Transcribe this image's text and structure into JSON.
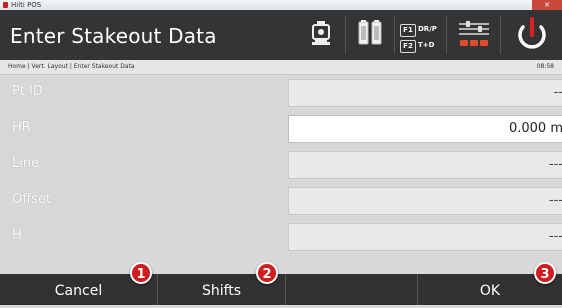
{
  "window": {
    "title": "Hilti POS",
    "close_glyph": "✕"
  },
  "header": {
    "title": "Enter Stakeout Data",
    "f1_key": "F1",
    "f1_label": "DR/P",
    "f2_key": "F2",
    "f2_label": "T+D"
  },
  "breadcrumb": {
    "path": "Home | Vert. Layout | Enter Stakeout Data",
    "time": "08:58"
  },
  "form": {
    "rows": [
      {
        "label": "Pt ID",
        "value": "--",
        "editable": false
      },
      {
        "label": "HR",
        "value": "0.000 m",
        "editable": true
      },
      {
        "label": "Line",
        "value": "---",
        "editable": false
      },
      {
        "label": "Offset",
        "value": "---",
        "editable": false
      },
      {
        "label": "H",
        "value": "---",
        "editable": false
      }
    ]
  },
  "footer": {
    "cancel_label": "Cancel",
    "shifts_label": "Shifts",
    "ok_label": "OK"
  },
  "markers": [
    "1",
    "2",
    "3"
  ],
  "colors": {
    "header_bg": "#323436",
    "accent_red": "#d01c1c"
  }
}
